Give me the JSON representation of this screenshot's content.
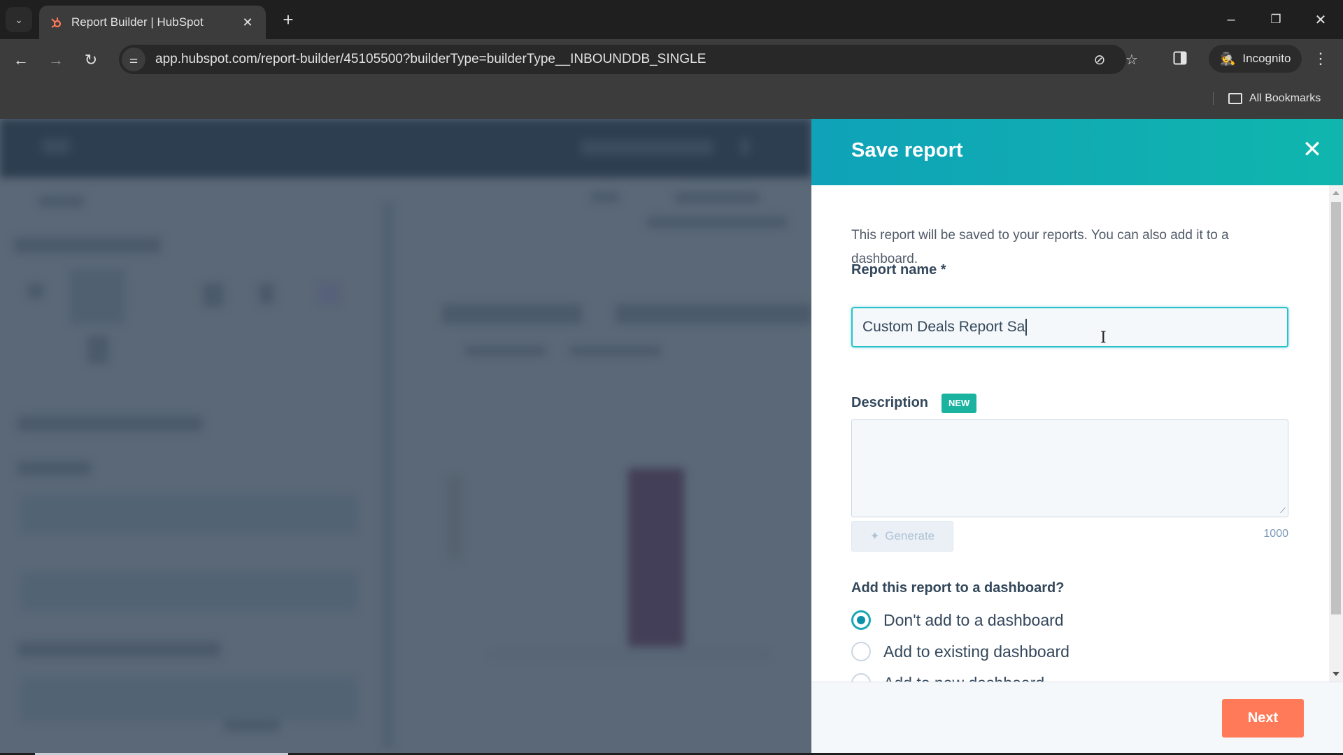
{
  "browser": {
    "tab_title": "Report Builder | HubSpot",
    "tab_close": "✕",
    "new_tab": "+",
    "url": "app.hubspot.com/report-builder/45105500?builderType=builderType__INBOUNDDB_SINGLE",
    "incognito_label": "Incognito",
    "all_bookmarks": "All Bookmarks",
    "icons": {
      "tab_search": "⌄",
      "favicon": "hubspot-sprocket",
      "back": "←",
      "forward": "→",
      "reload": "↻",
      "site_info": "⚌",
      "eye_off": "⊘",
      "star": "☆",
      "minimize": "–",
      "restore": "❐",
      "close": "✕",
      "kebab": "⋮",
      "incognito": "🕵"
    }
  },
  "modal": {
    "title": "Save report",
    "close_icon": "✕",
    "intro": "This report will be saved to your reports. You can also add it to a dashboard.",
    "report_name": {
      "label": "Report name *",
      "value": "Custom Deals Report Sa"
    },
    "description": {
      "label": "Description",
      "badge": "NEW",
      "value": "",
      "char_count": "1000"
    },
    "generate_button": {
      "icon": "✦",
      "label": "Generate",
      "disabled": true
    },
    "dashboard_question": "Add this report to a dashboard?",
    "dashboard_options": [
      {
        "label": "Don't add to a dashboard",
        "selected": true
      },
      {
        "label": "Add to existing dashboard",
        "selected": false
      },
      {
        "label": "Add to new dashboard",
        "selected": false
      }
    ],
    "next_button": "Next"
  },
  "colors": {
    "header_gradient_start": "#0fa2b8",
    "header_gradient_end": "#10b6ad",
    "primary_button": "#ff7a59",
    "new_badge": "#1ab39f",
    "radio_accent": "#0d91a8",
    "overlay": "#5a6877"
  }
}
